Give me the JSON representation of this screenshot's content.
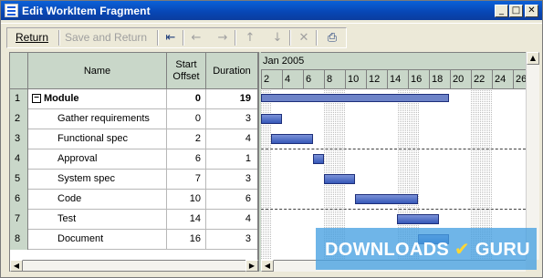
{
  "window": {
    "title": "Edit WorkItem Fragment"
  },
  "title_buttons": {
    "minimize": "_",
    "maximize": "□",
    "close": "✕"
  },
  "toolbar": {
    "return_label": "Return",
    "save_return_label": "Save and Return",
    "icons": [
      "indent-icon",
      "arrow-left-icon",
      "arrow-right-icon",
      "arrow-up-icon",
      "arrow-down-icon",
      "delete-icon",
      "print-icon"
    ]
  },
  "grid": {
    "headers": {
      "name": "Name",
      "start": "Start\nOffset",
      "duration": "Duration"
    },
    "rows": [
      {
        "num": "1",
        "name": "Module",
        "start": "0",
        "duration": "19",
        "summary": true
      },
      {
        "num": "2",
        "name": "Gather requirements",
        "start": "0",
        "duration": "3"
      },
      {
        "num": "3",
        "name": "Functional spec",
        "start": "2",
        "duration": "4"
      },
      {
        "num": "4",
        "name": "Approval",
        "start": "6",
        "duration": "1"
      },
      {
        "num": "5",
        "name": "System spec",
        "start": "7",
        "duration": "3"
      },
      {
        "num": "6",
        "name": "Code",
        "start": "10",
        "duration": "6"
      },
      {
        "num": "7",
        "name": "Test",
        "start": "14",
        "duration": "4"
      },
      {
        "num": "8",
        "name": "Document",
        "start": "16",
        "duration": "3"
      }
    ]
  },
  "gantt": {
    "month": "Jan 2005",
    "days": [
      "2",
      "4",
      "6",
      "8",
      "10",
      "12",
      "14",
      "16",
      "18",
      "20",
      "22",
      "24",
      "26"
    ]
  },
  "watermark": {
    "text": "DOWNLOADS",
    "suffix": "GURU",
    "check": "✔"
  }
}
